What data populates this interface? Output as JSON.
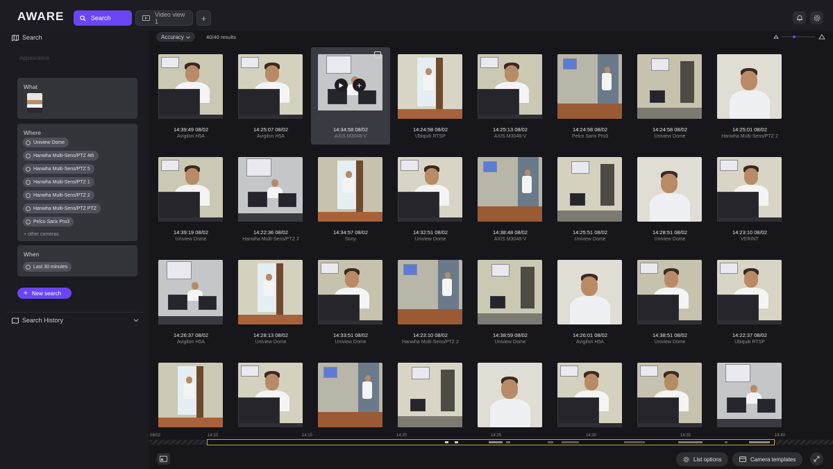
{
  "app": {
    "logo": "AWARE"
  },
  "tabs": [
    {
      "label": "Search",
      "icon": "search-icon",
      "active": true
    },
    {
      "label": "Video view 1",
      "icon": "video-icon",
      "active": false
    }
  ],
  "tab_add_label": "+",
  "colors": {
    "accent": "#6a45f5",
    "timeline_selection": "#c9a130"
  },
  "sidebar": {
    "title": "Search",
    "appearance_label": "Appearance",
    "what": {
      "title": "What"
    },
    "where": {
      "title": "Where",
      "cameras": [
        "Uniview Dome",
        "Hanwha Multi-Sens/PTZ 4th",
        "Hanwha Multi-Sens/PTZ 5",
        "Hanwha Multi-Sens/PTZ 1",
        "Hanwha Multi-Sens/PTZ 2",
        "Hanwha Multi-Sens/PTZ PTZ",
        "Pelco Sarix Pro3"
      ],
      "other_cameras": "+ other cameras"
    },
    "when": {
      "title": "When",
      "value": "Last 30 minutes"
    },
    "new_search": "New search",
    "history": "Search History"
  },
  "results": {
    "sort_label": "Accuracy",
    "count": "40/40 results",
    "items": [
      {
        "time": "14:39:49 08/02",
        "camera": "Avigilon H5A"
      },
      {
        "time": "14:25:07 08/02",
        "camera": "Avigilon H5A"
      },
      {
        "time": "14:34:58 08/02",
        "camera": "AXIS M3048-V",
        "selected": true
      },
      {
        "time": "14:24:58 08/02",
        "camera": "Ubiquiti RTSP"
      },
      {
        "time": "14:25:13 08/02",
        "camera": "AXIS M3048-V"
      },
      {
        "time": "14:24:58 08/02",
        "camera": "Pelco Sarix Pro3"
      },
      {
        "time": "14:24:58 08/02",
        "camera": "Uniview Dome"
      },
      {
        "time": "14:25:01 08/02",
        "camera": "Hanwha Multi-Sens/PTZ 2"
      },
      {
        "time": "14:39:19 08/02",
        "camera": "Uniview Dome"
      },
      {
        "time": "14:22:36 08/02",
        "camera": "Hanwha Multi-Sens/PTZ 2"
      },
      {
        "time": "14:34:57 08/02",
        "camera": "Sony"
      },
      {
        "time": "14:32:51 08/02",
        "camera": "Uniview Dome"
      },
      {
        "time": "14:38:48 08/02",
        "camera": "AXIS M3048-V"
      },
      {
        "time": "14:25:51 08/02",
        "camera": "Uniview Dome"
      },
      {
        "time": "14:28:51 08/02",
        "camera": "Uniview Dome"
      },
      {
        "time": "14:23:10 08/02",
        "camera": "VERINT"
      },
      {
        "time": "14:26:37 08/02",
        "camera": "Avigilon H5A"
      },
      {
        "time": "14:28:13 08/02",
        "camera": "Uniview Dome"
      },
      {
        "time": "14:33:51 08/02",
        "camera": "Uniview Dome"
      },
      {
        "time": "14:23:10 08/02",
        "camera": "Hanwha Multi-Sens/PTZ 2"
      },
      {
        "time": "14:38:59 08/02",
        "camera": "Uniview Dome"
      },
      {
        "time": "14:26:01 08/02",
        "camera": "Avigilon H5A"
      },
      {
        "time": "14:38:51 08/02",
        "camera": "Uniview Dome"
      },
      {
        "time": "14:22:37 08/02",
        "camera": "Ubiquiti RTSP"
      },
      {
        "time": "",
        "camera": ""
      },
      {
        "time": "",
        "camera": ""
      },
      {
        "time": "",
        "camera": ""
      },
      {
        "time": "",
        "camera": ""
      },
      {
        "time": "",
        "camera": ""
      },
      {
        "time": "",
        "camera": ""
      },
      {
        "time": "",
        "camera": ""
      },
      {
        "time": "",
        "camera": ""
      }
    ]
  },
  "timeline": {
    "labels": [
      "08/02",
      "14:10",
      "14:15",
      "14:20",
      "14:25",
      "14:30",
      "14:35",
      "14:40"
    ]
  },
  "bottom": {
    "list_options": "List options",
    "camera_templates": "Camera templates"
  }
}
